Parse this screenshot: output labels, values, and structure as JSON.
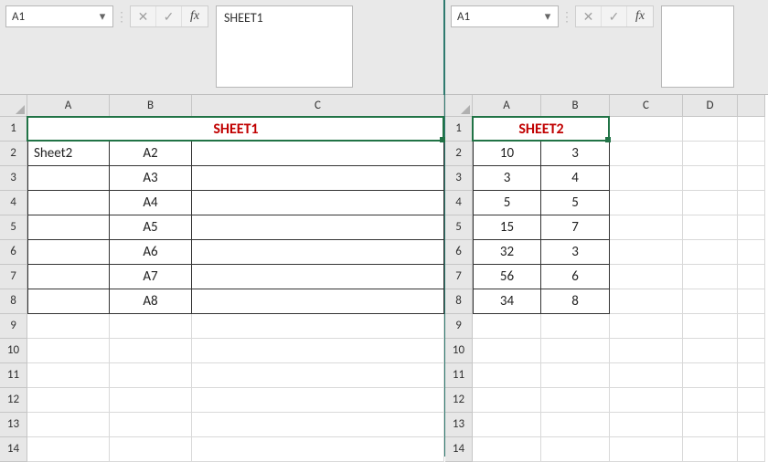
{
  "left": {
    "namebox": "A1",
    "formula": "SHEET1",
    "columns": [
      "A",
      "B",
      "C"
    ],
    "rows": [
      "1",
      "2",
      "3",
      "4",
      "5",
      "6",
      "7",
      "8",
      "9",
      "10",
      "11",
      "12",
      "13",
      "14"
    ],
    "title": "SHEET1",
    "data": {
      "r2": {
        "a": "Sheet2",
        "b": "A2"
      },
      "r3": {
        "a": "",
        "b": "A3"
      },
      "r4": {
        "a": "",
        "b": "A4"
      },
      "r5": {
        "a": "",
        "b": "A5"
      },
      "r6": {
        "a": "",
        "b": "A6"
      },
      "r7": {
        "a": "",
        "b": "A7"
      },
      "r8": {
        "a": "",
        "b": "A8"
      }
    }
  },
  "right": {
    "namebox": "A1",
    "formula": "",
    "columns": [
      "A",
      "B",
      "C",
      "D"
    ],
    "rows": [
      "1",
      "2",
      "3",
      "4",
      "5",
      "6",
      "7",
      "8",
      "9",
      "10",
      "11",
      "12",
      "13",
      "14"
    ],
    "title": "SHEET2",
    "data": {
      "r2": {
        "a": "10",
        "b": "3"
      },
      "r3": {
        "a": "3",
        "b": "4"
      },
      "r4": {
        "a": "5",
        "b": "5"
      },
      "r5": {
        "a": "15",
        "b": "7"
      },
      "r6": {
        "a": "32",
        "b": "3"
      },
      "r7": {
        "a": "56",
        "b": "6"
      },
      "r8": {
        "a": "34",
        "b": "8"
      }
    }
  },
  "icons": {
    "cancel": "✕",
    "enter": "✓",
    "fx": "fx",
    "dropdown": "▾",
    "sep": "⋮"
  }
}
